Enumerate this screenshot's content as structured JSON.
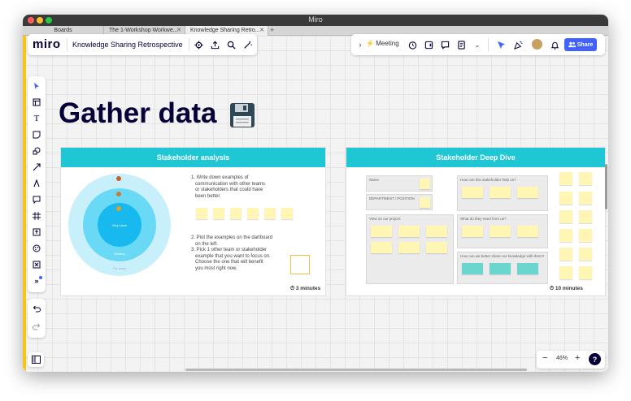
{
  "window": {
    "title": "Miro"
  },
  "tabs": [
    {
      "label": "Boards"
    },
    {
      "label": "The 1-Workshop Workwe..."
    },
    {
      "label": "Knowledge Sharing Retro..."
    }
  ],
  "header": {
    "logo": "miro",
    "board_name": "Knowledge Sharing Retrospective",
    "meeting_label": "Meeting",
    "share_label": "Share"
  },
  "canvas": {
    "title": "Gather data",
    "zoom": "46%"
  },
  "frames": {
    "left": {
      "title": "Stakeholder analysis",
      "steps_a": [
        "1. Write down examples of",
        "communication with other teams",
        "or stakeholders that could have",
        "been better."
      ],
      "steps_b": [
        "2. Plot the examples on the dartboard",
        "on the left.",
        "3. Pick 1 other team or stakeholder",
        "example that you want to focus on.",
        "Choose the one that will benefit",
        "you most right now."
      ],
      "dart_inner": "Very close",
      "dart_middle": "Nearby",
      "dart_outer": "Far away",
      "timer": "3 minutes"
    },
    "right": {
      "title": "Stakeholder Deep Dive",
      "labels": {
        "name": "Name",
        "department": "DEPARTMENT / POSITION",
        "view": "View on our project",
        "help": "How can this stakeholder help us?",
        "need": "What do they need from us?",
        "share": "How can we better share our knowledge with them?"
      },
      "timer": "10 minutes"
    }
  },
  "icons": [
    "settings-icon",
    "upload-icon",
    "search-icon",
    "magic-icon",
    "chevron-right-icon",
    "lightning-icon",
    "timer-icon",
    "video-icon",
    "comment-icon",
    "notes-icon",
    "chevron-double-down-icon",
    "cursor-icon",
    "celebrate-icon",
    "bell-icon",
    "users-icon"
  ],
  "colors": {
    "accent": "#4262ff",
    "frame_header": "#1fc7d4",
    "sticky": "#fff6b6",
    "teal_sticky": "#6ad6cd",
    "edge": "#f5c518"
  }
}
